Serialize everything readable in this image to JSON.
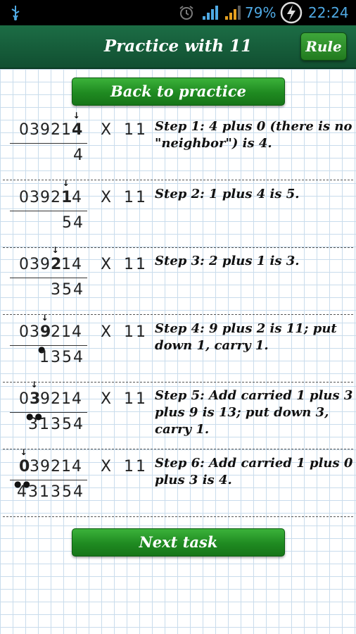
{
  "status": {
    "battery": "79%",
    "time": "22:24"
  },
  "header": {
    "title": "Practice with 11",
    "rule_label": "Rule"
  },
  "back_label": "Back to practice",
  "next_label": "Next task",
  "times_sign": "X",
  "multiplier": "11",
  "number_digits": [
    "0",
    "3",
    "9",
    "2",
    "1",
    "4"
  ],
  "steps": [
    {
      "result": "4",
      "text": "Step 1: 4 plus 0 (there is no \"neighbor\") is 4."
    },
    {
      "result": "54",
      "text": "Step 2: 1 plus 4 is 5."
    },
    {
      "result": "354",
      "text": "Step 3: 2 plus 1 is 3."
    },
    {
      "result": "1354",
      "text": "Step 4: 9 plus 2 is 11; put down 1, carry 1."
    },
    {
      "result": "31354",
      "text": "Step 5: Add carried 1 plus 3 plus 9 is 13; put down 3, carry 1."
    },
    {
      "result": "431354",
      "text": "Step 6: Add carried 1 plus 0 plus 3 is 4."
    }
  ]
}
